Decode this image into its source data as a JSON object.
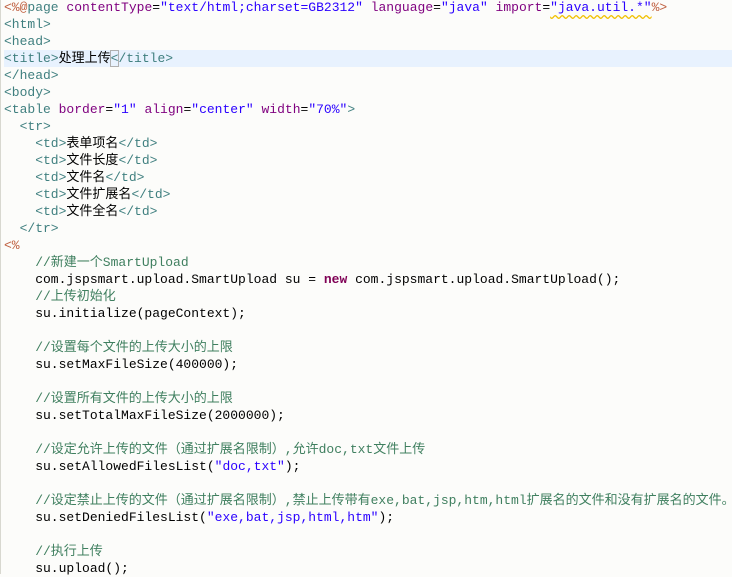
{
  "editor": {
    "current_line": 3,
    "lines": [
      [
        [
          "<%@",
          "dir"
        ],
        [
          "page",
          "tag"
        ],
        [
          " contentType",
          "attr"
        ],
        [
          "=",
          "txt"
        ],
        [
          "\"text/html;charset=GB2312\"",
          "val"
        ],
        [
          " language",
          "attr"
        ],
        [
          "=",
          "txt"
        ],
        [
          "\"java\"",
          "val"
        ],
        [
          " import",
          "attr"
        ],
        [
          "=",
          "txt"
        ],
        [
          "\"java.util.*\"",
          "val warn"
        ],
        [
          "%>",
          "dir"
        ]
      ],
      [
        [
          "<html>",
          "tag"
        ]
      ],
      [
        [
          "<head>",
          "tag"
        ]
      ],
      [
        [
          "<title>",
          "tag"
        ],
        [
          "处理上传",
          "txt"
        ],
        [
          "<",
          "tag caret"
        ],
        [
          "/title>",
          "tag"
        ]
      ],
      [
        [
          "</head>",
          "tag"
        ]
      ],
      [
        [
          "<body>",
          "tag"
        ]
      ],
      [
        [
          "<table",
          "tag"
        ],
        [
          " border",
          "attr"
        ],
        [
          "=",
          "txt"
        ],
        [
          "\"1\"",
          "val"
        ],
        [
          " align",
          "attr"
        ],
        [
          "=",
          "txt"
        ],
        [
          "\"center\"",
          "val"
        ],
        [
          " width",
          "attr"
        ],
        [
          "=",
          "txt"
        ],
        [
          "\"70%\"",
          "val"
        ],
        [
          ">",
          "tag"
        ]
      ],
      [
        [
          "  <tr>",
          "tag"
        ]
      ],
      [
        [
          "    <td>",
          "tag"
        ],
        [
          "表单项名",
          "txt"
        ],
        [
          "</td>",
          "tag"
        ]
      ],
      [
        [
          "    <td>",
          "tag"
        ],
        [
          "文件长度",
          "txt"
        ],
        [
          "</td>",
          "tag"
        ]
      ],
      [
        [
          "    <td>",
          "tag"
        ],
        [
          "文件名",
          "txt"
        ],
        [
          "</td>",
          "tag"
        ]
      ],
      [
        [
          "    <td>",
          "tag"
        ],
        [
          "文件扩展名",
          "txt"
        ],
        [
          "</td>",
          "tag"
        ]
      ],
      [
        [
          "    <td>",
          "tag"
        ],
        [
          "文件全名",
          "txt"
        ],
        [
          "</td>",
          "tag"
        ]
      ],
      [
        [
          "  </tr>",
          "tag"
        ]
      ],
      [
        [
          "<%",
          "dir"
        ]
      ],
      [
        [
          "    //新建一个SmartUpload",
          "cm"
        ]
      ],
      [
        [
          "    com.jspsmart.upload.SmartUpload su = ",
          "txt"
        ],
        [
          "new",
          "kw"
        ],
        [
          " com.jspsmart.upload.SmartUpload();",
          "txt"
        ]
      ],
      [
        [
          "    //上传初始化",
          "cm"
        ]
      ],
      [
        [
          "    su.initialize(pageContext);",
          "txt"
        ]
      ],
      [],
      [
        [
          "    //设置每个文件的上传大小的上限",
          "cm"
        ]
      ],
      [
        [
          "    su.setMaxFileSize(400000);",
          "txt"
        ]
      ],
      [],
      [
        [
          "    //设置所有文件的上传大小的上限",
          "cm"
        ]
      ],
      [
        [
          "    su.setTotalMaxFileSize(2000000);",
          "txt"
        ]
      ],
      [],
      [
        [
          "    //设定允许上传的文件（通过扩展名限制）,允许doc,txt文件上传",
          "cm"
        ]
      ],
      [
        [
          "    su.setAllowedFilesList(",
          "txt"
        ],
        [
          "\"doc,txt\"",
          "val"
        ],
        [
          ");",
          "txt"
        ]
      ],
      [],
      [
        [
          "    //设定禁止上传的文件（通过扩展名限制）,禁止上传带有exe,bat,jsp,htm,html扩展名的文件和没有扩展名的文件。",
          "cm"
        ]
      ],
      [
        [
          "    su.setDeniedFilesList(",
          "txt"
        ],
        [
          "\"exe,bat,jsp,html,htm\"",
          "val"
        ],
        [
          ");",
          "txt"
        ]
      ],
      [],
      [
        [
          "    //执行上传",
          "cm"
        ]
      ],
      [
        [
          "    su.upload();",
          "txt"
        ]
      ]
    ]
  }
}
